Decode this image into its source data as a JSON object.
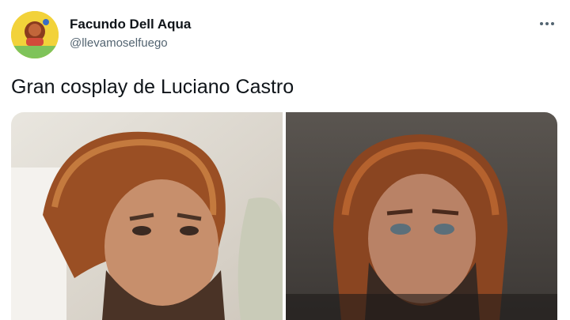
{
  "tweet": {
    "author_name": "Facundo Dell Aqua",
    "author_handle": "@llevamoselfuego",
    "text": "Gran cosplay de Luciano Castro",
    "more_icon": "more-dots-icon"
  },
  "media": {
    "photos": [
      {
        "subject": "man with curly auburn hair and beard looking up"
      },
      {
        "subject": "bearded man with curly red-brown hair against dark sky"
      }
    ]
  },
  "colors": {
    "text_primary": "#0f1419",
    "text_secondary": "#536471",
    "avatar_bg": "#f2d23a"
  }
}
